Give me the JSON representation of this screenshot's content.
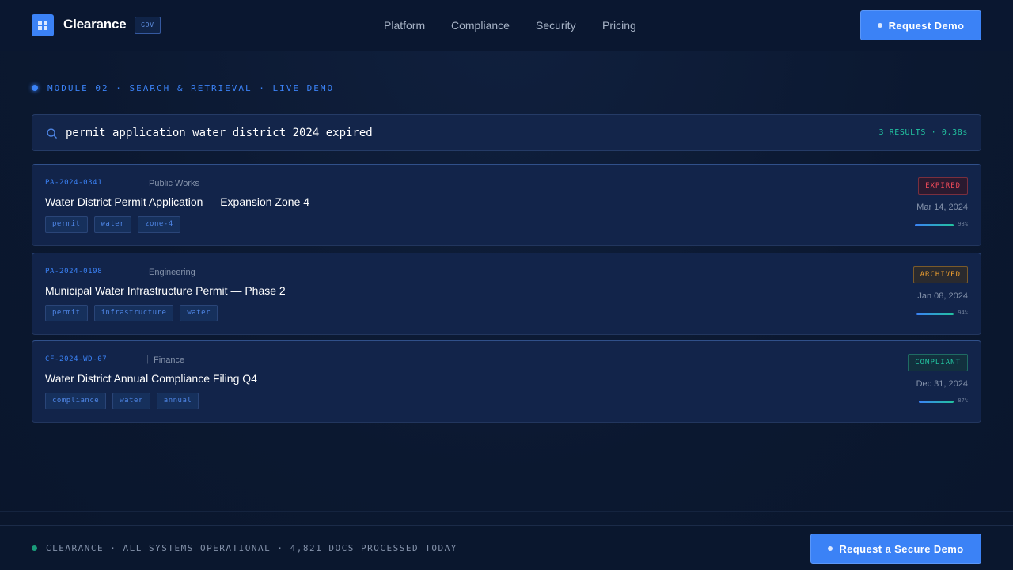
{
  "header": {
    "brand": "Clearance",
    "badge": "GOV",
    "nav": [
      "Platform",
      "Compliance",
      "Security",
      "Pricing"
    ],
    "cta": "Request Demo"
  },
  "module_label": "MODULE 02 · SEARCH & RETRIEVAL · LIVE DEMO",
  "search": {
    "query": "permit application water district 2024 expired",
    "meta": "3 RESULTS · 0.38s"
  },
  "results": [
    {
      "id": "PA-2024-0341",
      "dept": "Public Works",
      "title": "Water District Permit Application — Expansion Zone 4",
      "tags": [
        "permit",
        "water",
        "zone-4"
      ],
      "status": "EXPIRED",
      "date": "Mar 14, 2024",
      "confidence": "98%"
    },
    {
      "id": "PA-2024-0198",
      "dept": "Engineering",
      "title": "Municipal Water Infrastructure Permit — Phase 2",
      "tags": [
        "permit",
        "infrastructure",
        "water"
      ],
      "status": "ARCHIVED",
      "date": "Jan 08, 2024",
      "confidence": "94%"
    },
    {
      "id": "CF-2024-WD-07",
      "dept": "Finance",
      "title": "Water District Annual Compliance Filing Q4",
      "tags": [
        "compliance",
        "water",
        "annual"
      ],
      "status": "COMPLIANT",
      "date": "Dec 31, 2024",
      "confidence": "87%"
    }
  ],
  "footer": {
    "status": "CLEARANCE · ALL SYSTEMS OPERATIONAL · 4,821 DOCS PROCESSED TODAY",
    "cta": "Request a Secure Demo"
  },
  "colors": {
    "accent": "#3b82f6",
    "teal": "#22c3a0",
    "expired": "#ef4a5a",
    "archived": "#f0a030"
  }
}
